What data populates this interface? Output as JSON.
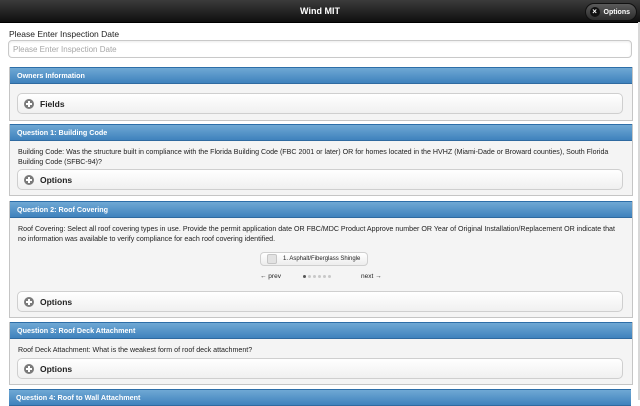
{
  "header": {
    "title": "Wind MIT",
    "options_label": "Options"
  },
  "inspection": {
    "label": "Please Enter Inspection Date",
    "placeholder": "Please Enter Inspection Date"
  },
  "sections": {
    "owners": {
      "title": "Owners Information",
      "collapsible_label": "Fields"
    },
    "q1": {
      "title": "Question 1: Building Code",
      "text": "Building Code: Was the structure built in compliance with the Florida Building Code (FBC 2001 or later) OR for homes located in the HVHZ (Miami-Dade or Broward counties), South Florida Building Code (SFBC-94)?",
      "collapsible_label": "Options"
    },
    "q2": {
      "title": "Question 2: Roof Covering",
      "text": "Roof Covering: Select all roof covering types in use. Provide the permit application date OR FBC/MDC Product Approve number OR Year of Original Installation/Replacement OR indicate that no information was available to verify compliance for each roof covering identified.",
      "card_label": "1. Asphalt/Fiberglass Shingle",
      "prev_label": "← prev",
      "next_label": "next →",
      "collapsible_label": "Options"
    },
    "q3": {
      "title": "Question 3: Roof Deck Attachment",
      "text": "Roof Deck Attachment: What is the weakest form of roof deck attachment?",
      "collapsible_label": "Options"
    },
    "q4": {
      "title": "Question 4: Roof to Wall Attachment"
    }
  }
}
